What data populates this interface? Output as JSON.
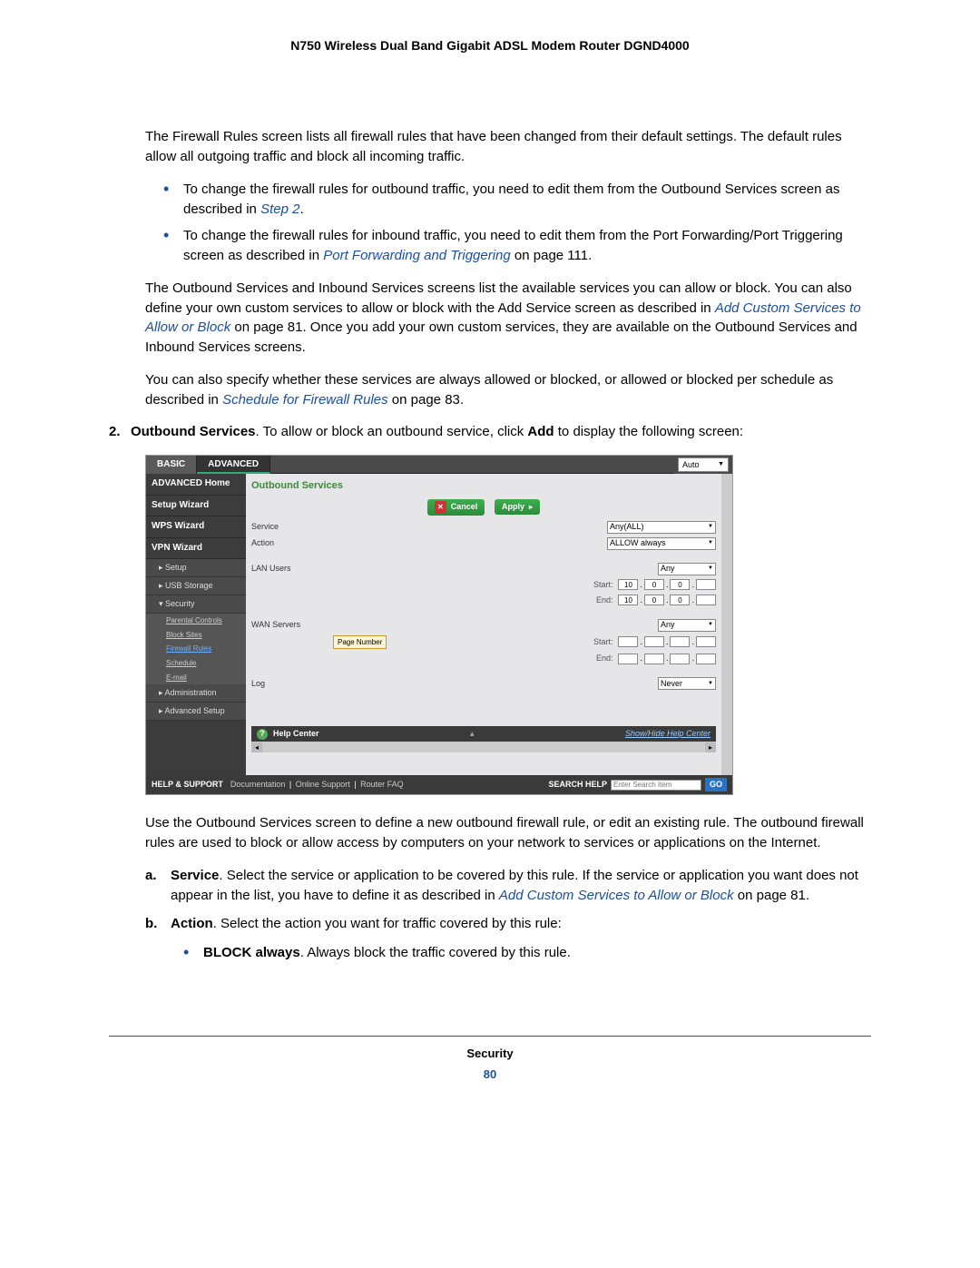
{
  "header_title": "N750 Wireless Dual Band Gigabit ADSL Modem Router DGND4000",
  "intro_paragraph": "The Firewall Rules screen lists all firewall rules that have been changed from their default settings. The default rules allow all outgoing traffic and block all incoming traffic.",
  "bullet1_a": "To change the firewall rules for outbound traffic, you need to edit them from the Outbound Services screen as described in ",
  "bullet1_link": "Step 2",
  "bullet1_b": ".",
  "bullet2_a": "To change the firewall rules for inbound traffic, you need to edit them from the Port Forwarding/Port Triggering screen as described in ",
  "bullet2_link": "Port Forwarding and Triggering",
  "bullet2_b": " on page 111.",
  "paragraph2_a": "The Outbound Services and Inbound Services screens list the available services you can allow or block. You can also define your own custom services to allow or block with the Add Service screen as described in ",
  "paragraph2_link": "Add Custom Services to Allow or Block",
  "paragraph2_b": " on page 81. Once you add your own custom services, they are available on the Outbound Services and Inbound Services screens.",
  "paragraph3_a": "You can also specify whether these services are always allowed or blocked, or allowed or blocked per schedule as described in ",
  "paragraph3_link": "Schedule for Firewall Rules",
  "paragraph3_b": " on page 83.",
  "step2_num": "2.",
  "step2_a": "Outbound Services",
  "step2_b": ". To allow or block an outbound service, click ",
  "step2_c": "Add",
  "step2_d": " to display the following screen:",
  "after_img": "Use the Outbound Services screen to define a new outbound firewall rule, or edit an existing rule. The outbound firewall rules are used to block or allow access by computers on your network to services or applications on the Internet.",
  "letter_a_lbl": "a.",
  "letter_a_bold": "Service",
  "letter_a_text": ". Select the service or application to be covered by this rule. If the service or application you want does not appear in the list, you have to define it as described in ",
  "letter_a_link": "Add Custom Services to Allow or Block",
  "letter_a_after": " on page 81.",
  "letter_b_lbl": "b.",
  "letter_b_bold": "Action",
  "letter_b_text": ". Select the action you want for traffic covered by this rule:",
  "sub_bullet_bold": "BLOCK always",
  "sub_bullet_text": ". Always block the traffic covered by this rule.",
  "footer_section": "Security",
  "footer_page": "80",
  "ui": {
    "tab_basic": "BASIC",
    "tab_advanced": "ADVANCED",
    "auto": "Auto",
    "sidebar": {
      "adv_home": "ADVANCED Home",
      "setup_wiz": "Setup Wizard",
      "wps_wiz": "WPS Wizard",
      "vpn_wiz": "VPN Wizard",
      "setup": "▸ Setup",
      "usb": "▸ USB Storage",
      "security": "▾ Security",
      "parental": "Parental Controls",
      "block_sites": "Block Sites",
      "firewall": "Firewall Rules",
      "schedule": "Schedule",
      "email": "E-mail",
      "admin": "▸ Administration",
      "adv_setup": "▸ Advanced Setup"
    },
    "main": {
      "title": "Outbound Services",
      "cancel": "Cancel",
      "apply": "Apply",
      "service_lbl": "Service",
      "service_val": "Any(ALL)",
      "action_lbl": "Action",
      "action_val": "ALLOW always",
      "lan_lbl": "LAN Users",
      "lan_sel": "Any",
      "start_lbl": "Start:",
      "end_lbl": "End:",
      "ip_val": "10",
      "ip_zero": "0",
      "wan_lbl": "WAN Servers",
      "wan_sel": "Any",
      "log_lbl": "Log",
      "log_sel": "Never",
      "page_num_btn": "Page Number",
      "help_center": "Help Center",
      "show_hide": "Show/Hide Help Center"
    },
    "footer": {
      "help_support": "HELP & SUPPORT",
      "doc": "Documentation",
      "online": "Online Support",
      "faq": "Router FAQ",
      "search_help": "SEARCH HELP",
      "placeholder": "Enter Search Item",
      "go": "GO"
    }
  }
}
